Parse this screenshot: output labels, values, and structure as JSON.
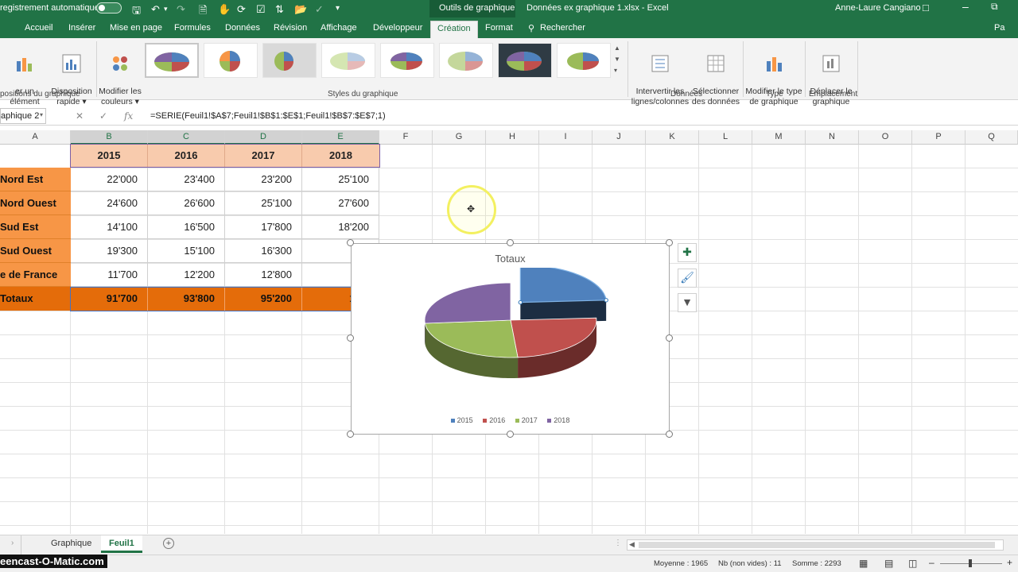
{
  "titlebar": {
    "autosave": "registrement automatique",
    "context_group": "Outils de graphique",
    "filename": "Données ex graphique 1.xlsx  -  Excel",
    "user": "Anne-Laure Cangiano"
  },
  "tabs": [
    "Accueil",
    "Insérer",
    "Mise en page",
    "Formules",
    "Données",
    "Révision",
    "Affichage",
    "Développeur",
    "Création",
    "Format"
  ],
  "active_tab": "Création",
  "search": "Rechercher",
  "share": "Pa",
  "ribbon": {
    "add_element": "er un élément\ngraphique ▾",
    "quick_layout": "Disposition\nrapide ▾",
    "change_colors": "Modifier les\ncouleurs ▾",
    "switch_row_col": "Intervertir les\nlignes/colonnes",
    "select_data": "Sélectionner\ndes données",
    "change_type": "Modifier le type\nde graphique",
    "move_chart": "Déplacer le\ngraphique",
    "group_layouts": "positions du graphique",
    "group_styles": "Styles du graphique",
    "group_data": "Données",
    "group_type": "Type",
    "group_location": "Emplacement"
  },
  "formula_bar": {
    "name_box": "aphique 2",
    "formula": "=SERIE(Feuil1!$A$7;Feuil1!$B$1:$E$1;Feuil1!$B$7:$E$7;1)"
  },
  "columns": [
    "A",
    "B",
    "C",
    "D",
    "E",
    "F",
    "G",
    "H",
    "I",
    "J",
    "K",
    "L",
    "M",
    "N",
    "O",
    "P",
    "Q"
  ],
  "table": {
    "years": [
      "2015",
      "2016",
      "2017",
      "2018"
    ],
    "rows": [
      {
        "label": "Nord Est",
        "values": [
          "22'000",
          "23'400",
          "23'200",
          "25'100"
        ]
      },
      {
        "label": "Nord Ouest",
        "values": [
          "24'600",
          "26'600",
          "25'100",
          "27'600"
        ]
      },
      {
        "label": "Sud Est",
        "values": [
          "14'100",
          "16'500",
          "17'800",
          "18'200"
        ]
      },
      {
        "label": "Sud Ouest",
        "values": [
          "19'300",
          "15'100",
          "16'300",
          "16'"
        ]
      },
      {
        "label": "e de France",
        "values": [
          "11'700",
          "12'200",
          "12'800",
          "12'"
        ]
      }
    ],
    "total": {
      "label": "Totaux",
      "values": [
        "91'700",
        "93'800",
        "95'200",
        "100'"
      ]
    }
  },
  "chart_data": {
    "type": "pie",
    "title": "Totaux",
    "categories": [
      "2015",
      "2016",
      "2017",
      "2018"
    ],
    "values": [
      91700,
      93800,
      95200,
      100500
    ],
    "colors": [
      "#4f81bd",
      "#c0504d",
      "#9bbb59",
      "#8064a2"
    ],
    "exploded": "2015",
    "style": "3d",
    "legend_position": "bottom"
  },
  "sheets": [
    "Graphique",
    "Feuil1"
  ],
  "active_sheet": "Feuil1",
  "status": {
    "average": "Moyenne : 1965",
    "count": "Nb (non vides) : 11",
    "sum": "Somme : 2293"
  },
  "watermark": "eencast-O-Matic.com",
  "icons": [
    "save-icon",
    "undo-icon",
    "redo-icon",
    "new-icon",
    "touch-mode-icon",
    "redo-alt-icon",
    "sort-icon",
    "open-icon",
    "check-icon",
    "search-icon",
    "add-element-icon",
    "filter-icon",
    "brush-icon",
    "plus-icon"
  ]
}
